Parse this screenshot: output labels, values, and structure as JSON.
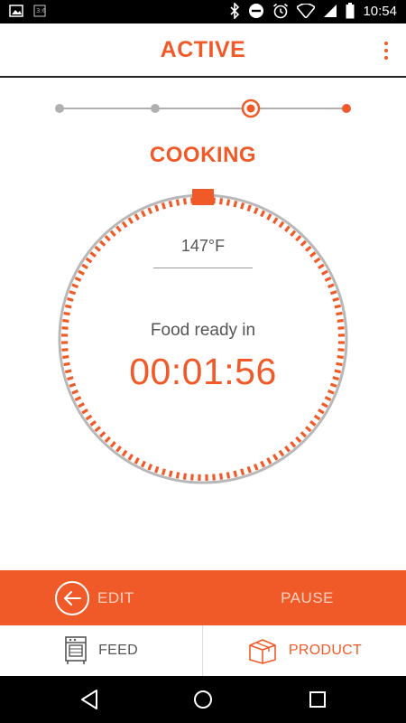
{
  "status_bar": {
    "time": "10:54",
    "icons": [
      "image-icon",
      "sim-icon",
      "bluetooth-icon",
      "do-not-disturb-icon",
      "alarm-icon",
      "wifi-icon",
      "signal-icon",
      "battery-icon"
    ]
  },
  "app_bar": {
    "title": "ACTIVE",
    "menu_icon": "more-vert-icon"
  },
  "stepper": {
    "steps": 4,
    "current_step": 3
  },
  "stage": {
    "title": "COOKING"
  },
  "dial": {
    "temperature": "147°F",
    "ready_label": "Food ready in",
    "timer": "00:01:56",
    "progress": 0.99
  },
  "actions": {
    "edit_label": "EDIT",
    "pause_label": "PAUSE"
  },
  "tabs": [
    {
      "label": "FEED",
      "icon": "oven-icon",
      "active": false
    },
    {
      "label": "PRODUCT",
      "icon": "box-icon",
      "active": true
    }
  ],
  "colors": {
    "accent": "#f05a28",
    "accent_light": "#fbd2c2",
    "inactive": "#b0b0b0"
  }
}
